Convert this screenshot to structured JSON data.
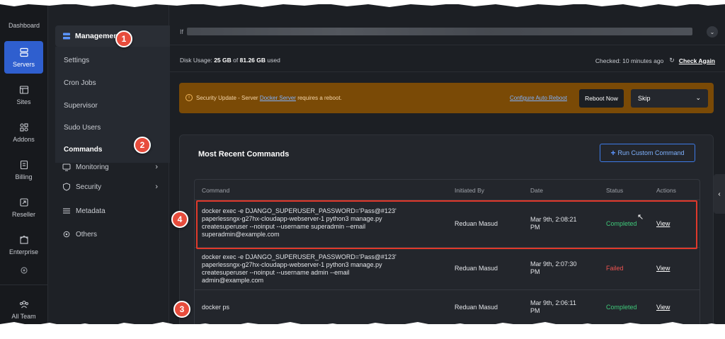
{
  "rail": {
    "dashboard": "Dashboard",
    "servers": "Servers",
    "sites": "Sites",
    "addons": "Addons",
    "billing": "Billing",
    "reseller": "Reseller",
    "enterprise": "Enterprise",
    "all_team": "All Team"
  },
  "submenu": {
    "management": "Management",
    "items": [
      "Settings",
      "Cron Jobs",
      "Supervisor",
      "Sudo Users",
      "Commands"
    ],
    "monitoring": "Monitoring",
    "security": "Security",
    "metadata": "Metadata",
    "others": "Others"
  },
  "header": {
    "server_prefix": "If",
    "disk_label": "Disk Usage:",
    "disk_used": "25 GB",
    "disk_of": "of",
    "disk_total": "81.26 GB",
    "disk_suffix": "used",
    "checked": "Checked: 10 minutes ago",
    "check_again": "Check Again"
  },
  "alert": {
    "text_before": "Security Update - Server",
    "server": "Docker Server",
    "text_after": "requires a reboot.",
    "auto_reboot": "Configure Auto Reboot",
    "reboot_now": "Reboot Now",
    "skip": "Skip"
  },
  "commands": {
    "title": "Most Recent Commands",
    "run_button": "Run Custom Command",
    "columns": [
      "Command",
      "Initiated By",
      "Date",
      "Status",
      "Actions"
    ],
    "rows": [
      {
        "command": [
          "docker exec -e DJANGO_SUPERUSER_PASSWORD='Pass@#123'",
          "paperlessngx-g27hx-cloudapp-webserver-1 python3 manage.py",
          "createsuperuser --noinput --username superadmin --email",
          "superadmin@example.com"
        ],
        "by": "Reduan Masud",
        "date": [
          "Mar 9th, 2:08:21",
          "PM"
        ],
        "status": "Completed",
        "action": "View"
      },
      {
        "command": [
          "docker exec -e DJANGO_SUPERUSER_PASSWORD='Pass@#123'",
          "paperlessngx-g27hx-cloudapp-webserver-1 python3 manage.py",
          "createsuperuser --noinput --username admin --email",
          "admin@example.com"
        ],
        "by": "Reduan Masud",
        "date": [
          "Mar 9th, 2:07:30",
          "PM"
        ],
        "status": "Failed",
        "action": "View"
      },
      {
        "command": [
          "docker ps"
        ],
        "by": "Reduan Masud",
        "date": [
          "Mar 9th, 2:06:11",
          "PM"
        ],
        "status": "Completed",
        "action": "View"
      }
    ]
  },
  "badges": [
    "1",
    "2",
    "3",
    "4"
  ],
  "colors": {
    "accent": "#2f5fcf",
    "alert_bg": "#7a4a06",
    "completed": "#3fc97a",
    "failed": "#ef5350",
    "highlight": "#e0392b"
  }
}
